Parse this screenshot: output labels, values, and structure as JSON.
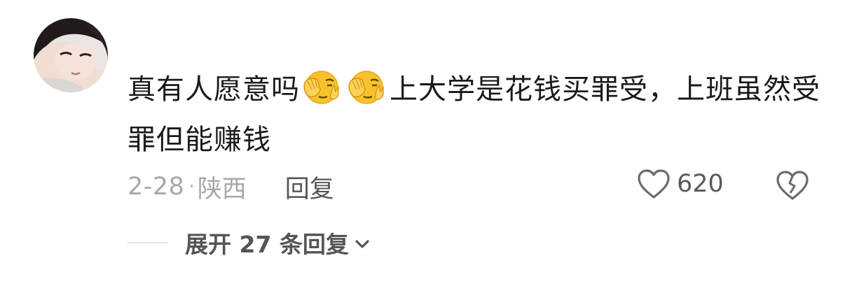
{
  "comment": {
    "text_part1": "真有人愿意吗",
    "emoji_name": "facepalm-emoji",
    "text_part2": "上大学是花钱买罪受，上班虽然受罪但能赚钱",
    "date": "2-28",
    "separator": "·",
    "location": "陕西",
    "reply_label": "回复",
    "like_count": "620"
  },
  "replies": {
    "expand_label": "展开 27 条回复"
  },
  "colors": {
    "text": "#1a1a1a",
    "meta": "#a8a8a8",
    "action": "#555555",
    "emoji_face": "#f8c22d"
  }
}
